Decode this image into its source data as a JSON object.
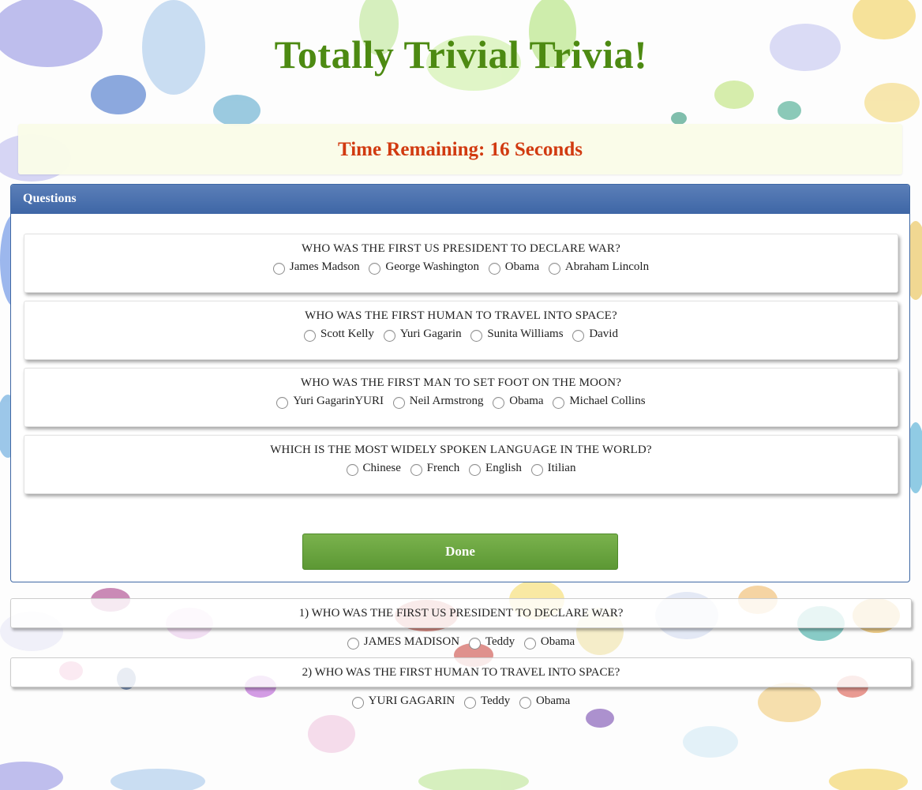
{
  "app": {
    "title": "Totally Trivial Trivia!"
  },
  "timer": {
    "text": "Time Remaining: 16 Seconds"
  },
  "panel": {
    "heading": "Questions",
    "questions": [
      {
        "text": "WHO WAS THE FIRST US PRESIDENT TO DECLARE WAR?",
        "options": [
          "James Madson",
          "George Washington",
          "Obama",
          "Abraham Lincoln"
        ]
      },
      {
        "text": "WHO WAS THE FIRST HUMAN TO TRAVEL INTO SPACE?",
        "options": [
          "Scott Kelly",
          "Yuri Gagarin",
          "Sunita Williams",
          "David"
        ]
      },
      {
        "text": "WHO WAS THE FIRST MAN TO SET FOOT ON THE MOON?",
        "options": [
          "Yuri GagarinYURI",
          "Neil Armstrong",
          "Obama",
          "Michael Collins"
        ]
      },
      {
        "text": "WHICH IS THE MOST WIDELY SPOKEN LANGUAGE IN THE WORLD?",
        "options": [
          "Chinese",
          "French",
          "English",
          "Itilian"
        ]
      }
    ],
    "done_label": "Done"
  },
  "results": [
    {
      "text": "1) WHO WAS THE FIRST US PRESIDENT TO DECLARE WAR?",
      "options": [
        "JAMES MADISON",
        "Teddy",
        "Obama"
      ]
    },
    {
      "text": "2) WHO WAS THE FIRST HUMAN TO TRAVEL INTO SPACE?",
      "options": [
        "YURI GAGARIN",
        "Teddy",
        "Obama"
      ]
    }
  ],
  "colors": {
    "title": "#4d8a12",
    "timer_text": "#d13a10",
    "timer_bg": "#fafce8",
    "panel_heading": "#3e66a6",
    "done_button": "#6aa53f"
  },
  "background": {
    "description_icon": "paint-splatter"
  }
}
